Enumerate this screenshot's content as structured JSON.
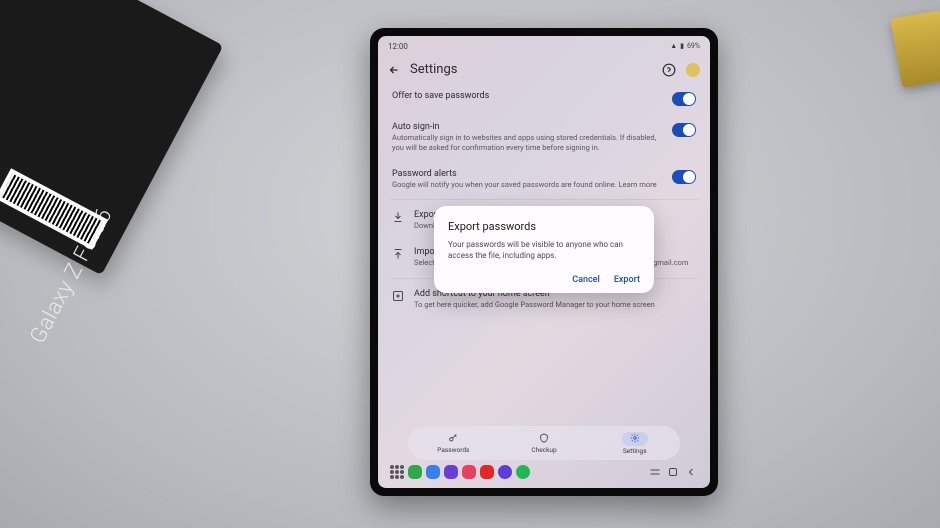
{
  "box": {
    "product": "Galaxy Z Fold6"
  },
  "status": {
    "time": "12:00",
    "battery": "69%"
  },
  "header": {
    "title": "Settings"
  },
  "settings": {
    "saveOffer": {
      "title": "Offer to save passwords"
    },
    "autoSignIn": {
      "title": "Auto sign-in",
      "desc": "Automatically sign in to websites and apps using stored credentials. If disabled, you will be asked for confirmation every time before signing in."
    },
    "alerts": {
      "title": "Password alerts",
      "desc": "Google will notify you when your saved passwords are found online. Learn more"
    },
    "export": {
      "title": "Export passwords",
      "desc": "Download a copy of your passwords"
    },
    "import": {
      "title": "Import passwords",
      "desc": "Select a file to import passwords to Google Password Manager for",
      "email": "cw@gmail.com"
    },
    "shortcut": {
      "title": "Add shortcut to your home screen",
      "desc": "To get here quicker, add Google Password Manager to your home screen"
    }
  },
  "dialog": {
    "title": "Export passwords",
    "body": "Your passwords will be visible to anyone who can access the file, including apps.",
    "cancel": "Cancel",
    "confirm": "Export"
  },
  "tabs": {
    "passwords": "Passwords",
    "checkup": "Checkup",
    "settings": "Settings"
  }
}
